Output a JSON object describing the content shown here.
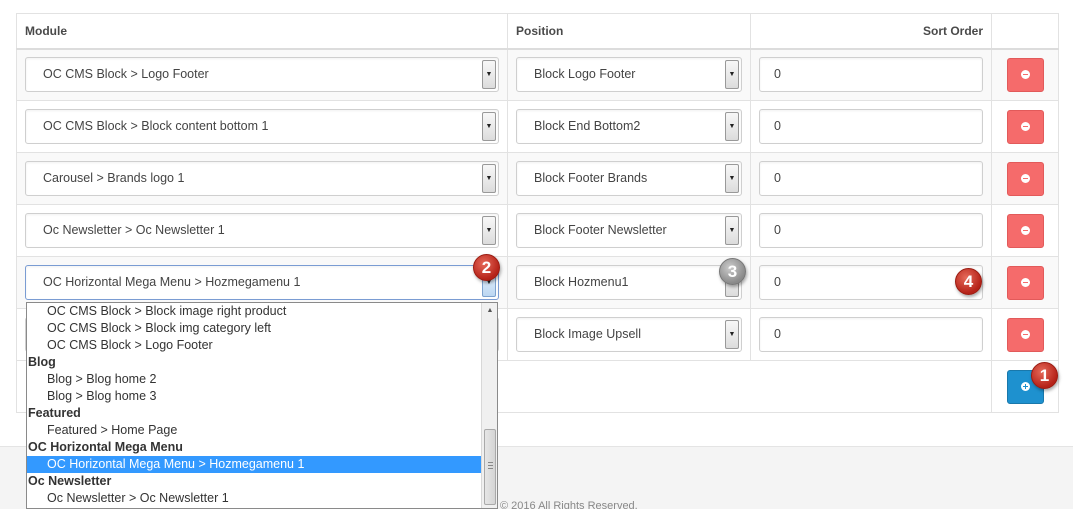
{
  "table": {
    "headers": {
      "module": "Module",
      "position": "Position",
      "sort_order": "Sort Order"
    },
    "rows": [
      {
        "module": "OC CMS Block > Logo Footer",
        "position": "Block Logo Footer",
        "sort_order": "0"
      },
      {
        "module": "OC CMS Block > Block content bottom 1",
        "position": "Block End Bottom2",
        "sort_order": "0"
      },
      {
        "module": "Carousel > Brands logo 1",
        "position": "Block Footer Brands",
        "sort_order": "0"
      },
      {
        "module": "Oc Newsletter > Oc Newsletter 1",
        "position": "Block Footer Newsletter",
        "sort_order": "0"
      },
      {
        "module": "OC Horizontal Mega Menu > Hozmegamenu 1",
        "position": "Block Hozmenu1",
        "sort_order": "0"
      },
      {
        "module": "",
        "position": "Block Image Upsell",
        "sort_order": "0"
      }
    ]
  },
  "dropdown": {
    "items": [
      {
        "type": "option",
        "label": "OC CMS Block > Block image right product"
      },
      {
        "type": "option",
        "label": "OC CMS Block > Block img category left"
      },
      {
        "type": "option",
        "label": "OC CMS Block > Logo Footer"
      },
      {
        "type": "group",
        "label": "Blog"
      },
      {
        "type": "option",
        "label": "Blog > Blog home 2"
      },
      {
        "type": "option",
        "label": "Blog > Blog home 3"
      },
      {
        "type": "group",
        "label": "Featured"
      },
      {
        "type": "option",
        "label": "Featured > Home Page"
      },
      {
        "type": "group",
        "label": "OC Horizontal Mega Menu"
      },
      {
        "type": "option",
        "label": "OC Horizontal Mega Menu > Hozmegamenu 1",
        "selected": true
      },
      {
        "type": "group",
        "label": "Oc Newsletter"
      },
      {
        "type": "option",
        "label": "Oc Newsletter > Oc Newsletter 1"
      }
    ]
  },
  "markers": {
    "m1": "1",
    "m2": "2",
    "m3": "3",
    "m4": "4"
  },
  "footer": {
    "text": "© 2016 All Rights Reserved."
  },
  "colors": {
    "danger": "#f56b6b",
    "primary": "#1e91cf",
    "selected": "#3399ff",
    "marker": "#c0392b"
  },
  "icons": {
    "remove": "minus-circle-icon",
    "add": "plus-circle-icon",
    "caret": "caret-down-icon"
  }
}
